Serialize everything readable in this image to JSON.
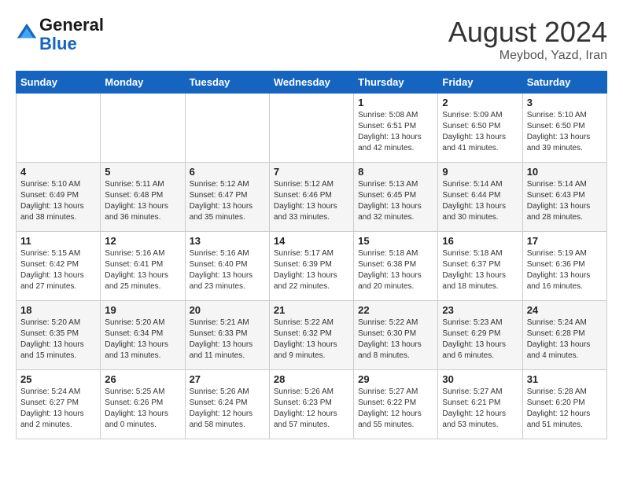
{
  "logo": {
    "text_general": "General",
    "text_blue": "Blue"
  },
  "title": "August 2024",
  "subtitle": "Meybod, Yazd, Iran",
  "days_of_week": [
    "Sunday",
    "Monday",
    "Tuesday",
    "Wednesday",
    "Thursday",
    "Friday",
    "Saturday"
  ],
  "weeks": [
    [
      {
        "day": "",
        "info": ""
      },
      {
        "day": "",
        "info": ""
      },
      {
        "day": "",
        "info": ""
      },
      {
        "day": "",
        "info": ""
      },
      {
        "day": "1",
        "info": "Sunrise: 5:08 AM\nSunset: 6:51 PM\nDaylight: 13 hours\nand 42 minutes."
      },
      {
        "day": "2",
        "info": "Sunrise: 5:09 AM\nSunset: 6:50 PM\nDaylight: 13 hours\nand 41 minutes."
      },
      {
        "day": "3",
        "info": "Sunrise: 5:10 AM\nSunset: 6:50 PM\nDaylight: 13 hours\nand 39 minutes."
      }
    ],
    [
      {
        "day": "4",
        "info": "Sunrise: 5:10 AM\nSunset: 6:49 PM\nDaylight: 13 hours\nand 38 minutes."
      },
      {
        "day": "5",
        "info": "Sunrise: 5:11 AM\nSunset: 6:48 PM\nDaylight: 13 hours\nand 36 minutes."
      },
      {
        "day": "6",
        "info": "Sunrise: 5:12 AM\nSunset: 6:47 PM\nDaylight: 13 hours\nand 35 minutes."
      },
      {
        "day": "7",
        "info": "Sunrise: 5:12 AM\nSunset: 6:46 PM\nDaylight: 13 hours\nand 33 minutes."
      },
      {
        "day": "8",
        "info": "Sunrise: 5:13 AM\nSunset: 6:45 PM\nDaylight: 13 hours\nand 32 minutes."
      },
      {
        "day": "9",
        "info": "Sunrise: 5:14 AM\nSunset: 6:44 PM\nDaylight: 13 hours\nand 30 minutes."
      },
      {
        "day": "10",
        "info": "Sunrise: 5:14 AM\nSunset: 6:43 PM\nDaylight: 13 hours\nand 28 minutes."
      }
    ],
    [
      {
        "day": "11",
        "info": "Sunrise: 5:15 AM\nSunset: 6:42 PM\nDaylight: 13 hours\nand 27 minutes."
      },
      {
        "day": "12",
        "info": "Sunrise: 5:16 AM\nSunset: 6:41 PM\nDaylight: 13 hours\nand 25 minutes."
      },
      {
        "day": "13",
        "info": "Sunrise: 5:16 AM\nSunset: 6:40 PM\nDaylight: 13 hours\nand 23 minutes."
      },
      {
        "day": "14",
        "info": "Sunrise: 5:17 AM\nSunset: 6:39 PM\nDaylight: 13 hours\nand 22 minutes."
      },
      {
        "day": "15",
        "info": "Sunrise: 5:18 AM\nSunset: 6:38 PM\nDaylight: 13 hours\nand 20 minutes."
      },
      {
        "day": "16",
        "info": "Sunrise: 5:18 AM\nSunset: 6:37 PM\nDaylight: 13 hours\nand 18 minutes."
      },
      {
        "day": "17",
        "info": "Sunrise: 5:19 AM\nSunset: 6:36 PM\nDaylight: 13 hours\nand 16 minutes."
      }
    ],
    [
      {
        "day": "18",
        "info": "Sunrise: 5:20 AM\nSunset: 6:35 PM\nDaylight: 13 hours\nand 15 minutes."
      },
      {
        "day": "19",
        "info": "Sunrise: 5:20 AM\nSunset: 6:34 PM\nDaylight: 13 hours\nand 13 minutes."
      },
      {
        "day": "20",
        "info": "Sunrise: 5:21 AM\nSunset: 6:33 PM\nDaylight: 13 hours\nand 11 minutes."
      },
      {
        "day": "21",
        "info": "Sunrise: 5:22 AM\nSunset: 6:32 PM\nDaylight: 13 hours\nand 9 minutes."
      },
      {
        "day": "22",
        "info": "Sunrise: 5:22 AM\nSunset: 6:30 PM\nDaylight: 13 hours\nand 8 minutes."
      },
      {
        "day": "23",
        "info": "Sunrise: 5:23 AM\nSunset: 6:29 PM\nDaylight: 13 hours\nand 6 minutes."
      },
      {
        "day": "24",
        "info": "Sunrise: 5:24 AM\nSunset: 6:28 PM\nDaylight: 13 hours\nand 4 minutes."
      }
    ],
    [
      {
        "day": "25",
        "info": "Sunrise: 5:24 AM\nSunset: 6:27 PM\nDaylight: 13 hours\nand 2 minutes."
      },
      {
        "day": "26",
        "info": "Sunrise: 5:25 AM\nSunset: 6:26 PM\nDaylight: 13 hours\nand 0 minutes."
      },
      {
        "day": "27",
        "info": "Sunrise: 5:26 AM\nSunset: 6:24 PM\nDaylight: 12 hours\nand 58 minutes."
      },
      {
        "day": "28",
        "info": "Sunrise: 5:26 AM\nSunset: 6:23 PM\nDaylight: 12 hours\nand 57 minutes."
      },
      {
        "day": "29",
        "info": "Sunrise: 5:27 AM\nSunset: 6:22 PM\nDaylight: 12 hours\nand 55 minutes."
      },
      {
        "day": "30",
        "info": "Sunrise: 5:27 AM\nSunset: 6:21 PM\nDaylight: 12 hours\nand 53 minutes."
      },
      {
        "day": "31",
        "info": "Sunrise: 5:28 AM\nSunset: 6:20 PM\nDaylight: 12 hours\nand 51 minutes."
      }
    ]
  ]
}
